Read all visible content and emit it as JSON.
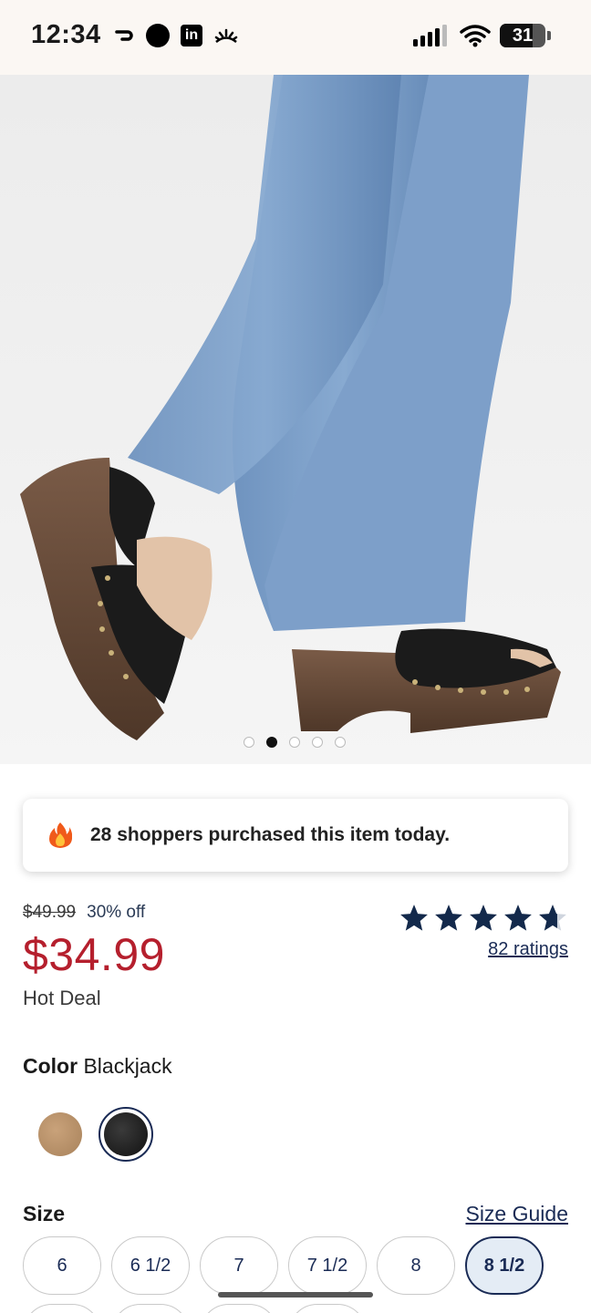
{
  "status_bar": {
    "time": "12:34",
    "battery": "31",
    "left_icons": [
      "arrow-icon",
      "dot-icon",
      "linkedin-icon",
      "sunrise-icon"
    ],
    "right_icons": [
      "signal-icon",
      "wifi-icon",
      "battery-icon"
    ]
  },
  "product_image": {
    "carousel_total": 5,
    "carousel_active": 2
  },
  "social_proof": {
    "icon": "fire-icon",
    "text": "28 shoppers purchased this item today."
  },
  "pricing": {
    "original_price": "$49.99",
    "discount": "30% off",
    "sale_price": "$34.99",
    "deal_label": "Hot Deal",
    "sale_color": "#b51f2d"
  },
  "rating": {
    "stars": 4.5,
    "ratings_link": "82 ratings"
  },
  "color": {
    "label": "Color",
    "selected_value": "Blackjack",
    "swatches": [
      "tan",
      "black"
    ],
    "selected_index": 1
  },
  "size": {
    "label": "Size",
    "guide_link": "Size Guide",
    "options": [
      "6",
      "6 1/2",
      "7",
      "7 1/2",
      "8",
      "8 1/2"
    ],
    "selected": "8 1/2"
  },
  "colors": {
    "accent_navy": "#1a2b55",
    "sale_red": "#b51f2d"
  }
}
